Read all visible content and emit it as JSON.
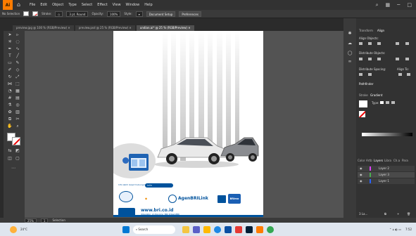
{
  "menubar": {
    "logo": "Ai",
    "items": [
      "File",
      "Edit",
      "Object",
      "Type",
      "Select",
      "Effect",
      "View",
      "Window",
      "Help"
    ]
  },
  "controlbar": {
    "selection": "No Selection",
    "stroke_label": "Stroke:",
    "brush": "3 pt. Round",
    "opacity_label": "Opacity:",
    "opacity": "100%",
    "style_label": "Style:",
    "doc_setup": "Document Setup",
    "preferences": "Preferences"
  },
  "tabs": [
    {
      "label": "preview.jpg @ 100 % (RGB/Preview)",
      "active": false
    },
    {
      "label": "preview.psd @ 25 % (RGB/Preview)",
      "active": false
    },
    {
      "label": "undian.ai* @ 25 % (RGB/Preview)",
      "active": true
    }
  ],
  "panel": {
    "tabs": [
      "Transform",
      "Align"
    ],
    "sections": [
      "Align Objects:",
      "Distribute Objects:",
      "Distribute Spacing:",
      "Align To:"
    ],
    "pathfinder": "Pathfinder",
    "stroke_tabs": [
      "Stroke",
      "Gradient"
    ],
    "gradient_type": "Type:",
    "layers_tabs": [
      "Color",
      "Artb",
      "Layers",
      "Libra",
      "Ch.a",
      "Para"
    ],
    "layers": [
      "Layer 2",
      "Layer 3",
      "Layer 1"
    ],
    "layers_footer": "3 La..."
  },
  "artwork": {
    "button_text": "Info",
    "caption": "Info lebih lanjut hubungi kami:",
    "brand1": "AgenBRILink",
    "brand2": "BRImo",
    "website": "www.bri.co.id",
    "socials": "@bankbri_id  @promo_BRI  @bankBRI"
  },
  "status": {
    "zoom": "25%",
    "page": "1",
    "mode": "Selection"
  },
  "taskbar": {
    "weather": "24°C",
    "search": "Search",
    "time": "7:52"
  }
}
